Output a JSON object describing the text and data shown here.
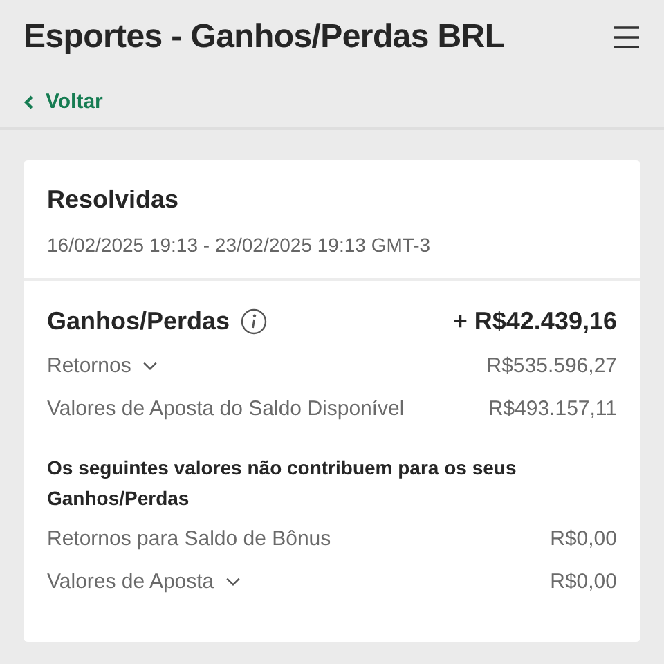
{
  "header": {
    "title": "Esportes - Ganhos/Perdas BRL",
    "back_link": "Voltar"
  },
  "card": {
    "title": "Resolvidas",
    "period": "16/02/2025 19:13 - 23/02/2025 19:13 GMT-3",
    "total": {
      "label": "Ganhos/Perdas",
      "value": "+ R$42.439,16"
    },
    "rows": [
      {
        "kind": "dropdown",
        "label": "Retornos",
        "value": "R$535.596,27"
      },
      {
        "kind": "plain",
        "label": "Valores de Aposta do Saldo Disponível",
        "value": "R$493.157,11"
      }
    ],
    "note": "Os seguintes valores não contribuem para os seus Ganhos/Perdas",
    "extra_rows": [
      {
        "kind": "plain",
        "label": "Retornos para Saldo de Bônus",
        "value": "R$0,00"
      },
      {
        "kind": "dropdown",
        "label": "Valores de Aposta",
        "value": "R$0,00"
      }
    ]
  }
}
